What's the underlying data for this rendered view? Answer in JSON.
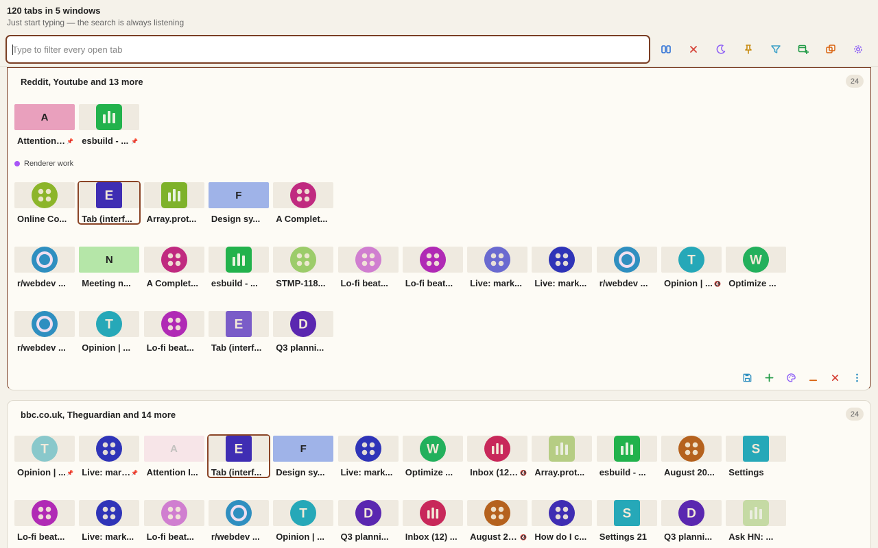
{
  "header": {
    "title": "120 tabs in 5 windows",
    "subtitle": "Just start typing — the search is always listening"
  },
  "search": {
    "placeholder": "Type to filter every open tab",
    "value": ""
  },
  "toolbar": [
    {
      "name": "split-view-icon",
      "color": "#2b6fd6"
    },
    {
      "name": "close-icon",
      "color": "#d6453a"
    },
    {
      "name": "moon-icon",
      "color": "#8b5cf6"
    },
    {
      "name": "pin-icon",
      "color": "#c78a0e"
    },
    {
      "name": "filter-icon",
      "color": "#3aa0c8"
    },
    {
      "name": "new-window-icon",
      "color": "#1f9a45"
    },
    {
      "name": "duplicate-icon",
      "color": "#d9630f"
    },
    {
      "name": "gear-icon",
      "color": "#8b5cf6"
    }
  ],
  "windows": [
    {
      "title": "Reddit, Youtube and 13 more",
      "count": "24",
      "group_label": "Renderer work",
      "pinned": [
        {
          "label": "Attention I...",
          "style": "flat",
          "letter": "A",
          "bg": "#e9a0bd",
          "pinned": true
        },
        {
          "label": "esbuild - ...",
          "style": "bars",
          "color": "#22b24c",
          "pinned": true
        }
      ],
      "group": [
        {
          "label": "Online Co...",
          "style": "dots",
          "color": "#8cb52a"
        },
        {
          "label": "Tab (interf...",
          "style": "letter",
          "letter": "E",
          "color": "#3f2db3",
          "active": true
        },
        {
          "label": "Array.prot...",
          "style": "bars",
          "color": "#7eb22a"
        },
        {
          "label": "Design sy...",
          "style": "flat",
          "letter": "F",
          "bg": "#9fb3e8"
        },
        {
          "label": "A Complet...",
          "style": "dots",
          "color": "#c02a80"
        }
      ],
      "row3": [
        {
          "label": "r/webdev ...",
          "style": "ring",
          "color": "#2f8fc0"
        },
        {
          "label": "Meeting n...",
          "style": "flat",
          "letter": "N",
          "bg": "#b5e6a8"
        },
        {
          "label": "A Complet...",
          "style": "dots",
          "color": "#c02a80"
        },
        {
          "label": "esbuild - ...",
          "style": "bars",
          "color": "#22b24c"
        },
        {
          "label": "STMP-118...",
          "style": "dots",
          "color": "#9ccc6a"
        },
        {
          "label": "Lo-fi beat...",
          "style": "dots",
          "color": "#d07ed0"
        },
        {
          "label": "Lo-fi beat...",
          "style": "dots",
          "color": "#b02ab5"
        },
        {
          "label": "Live: mark...",
          "style": "dots",
          "color": "#6a6ad0"
        },
        {
          "label": "Live: mark...",
          "style": "dots",
          "color": "#2f34b8"
        },
        {
          "label": "r/webdev ...",
          "style": "ring",
          "color": "#2f8fc0"
        },
        {
          "label": "Opinion | ...",
          "style": "letter",
          "letter": "T",
          "color": "#26a8b8",
          "muted": true
        },
        {
          "label": "Optimize ...",
          "style": "letter",
          "letter": "W",
          "color": "#23b05c"
        }
      ],
      "row4": [
        {
          "label": "r/webdev ...",
          "style": "ring",
          "color": "#2f8fc0"
        },
        {
          "label": "Opinion | ...",
          "style": "letter",
          "letter": "T",
          "color": "#26a8b8"
        },
        {
          "label": "Lo-fi beat...",
          "style": "dots",
          "color": "#b02ab5"
        },
        {
          "label": "Tab (interf...",
          "style": "letter",
          "letter": "E",
          "color": "#7a5cc8"
        },
        {
          "label": "Q3 planni...",
          "style": "letter",
          "letter": "D",
          "color": "#5a27b0"
        }
      ]
    },
    {
      "title": "bbc.co.uk, Theguardian and 14 more",
      "count": "24",
      "row1": [
        {
          "label": "Opinion | ...",
          "style": "letter",
          "letter": "T",
          "color": "#26a8b8",
          "faded": true,
          "pinned": true
        },
        {
          "label": "Live: mark...",
          "style": "dots",
          "color": "#2f34b8",
          "pinned": true
        },
        {
          "label": "Attention I...",
          "style": "flat",
          "letter": "A",
          "bg": "#e9a0bd",
          "faded": true
        },
        {
          "label": "Tab (interf...",
          "style": "letter",
          "letter": "E",
          "color": "#3f2db3",
          "active": true
        },
        {
          "label": "Design sy...",
          "style": "flat",
          "letter": "F",
          "bg": "#9fb3e8"
        },
        {
          "label": "Live: mark...",
          "style": "dots",
          "color": "#2f34b8"
        },
        {
          "label": "Optimize ...",
          "style": "letter",
          "letter": "W",
          "color": "#23b05c"
        },
        {
          "label": "Inbox (12) ...",
          "style": "bars",
          "color": "#c8285a",
          "muted": true
        },
        {
          "label": "Array.prot...",
          "style": "bars",
          "color": "#7eb22a",
          "faded": true
        },
        {
          "label": "esbuild - ...",
          "style": "bars",
          "color": "#22b24c"
        },
        {
          "label": "August 20...",
          "style": "dots",
          "color": "#b5621e"
        },
        {
          "label": "Settings",
          "style": "letter",
          "letter": "S",
          "color": "#26a8b8"
        }
      ],
      "row2": [
        {
          "label": "Lo-fi beat...",
          "style": "dots",
          "color": "#b02ab5"
        },
        {
          "label": "Live: mark...",
          "style": "dots",
          "color": "#2f34b8"
        },
        {
          "label": "Lo-fi beat...",
          "style": "dots",
          "color": "#d07ed0"
        },
        {
          "label": "r/webdev ...",
          "style": "ring",
          "color": "#2f8fc0"
        },
        {
          "label": "Opinion | ...",
          "style": "letter",
          "letter": "T",
          "color": "#26a8b8"
        },
        {
          "label": "Q3 planni...",
          "style": "letter",
          "letter": "D",
          "color": "#5a27b0"
        },
        {
          "label": "Inbox (12) ...",
          "style": "bars",
          "color": "#c8285a"
        },
        {
          "label": "August 20...",
          "style": "dots",
          "color": "#b5621e",
          "muted": true
        },
        {
          "label": "How do I c...",
          "style": "dots",
          "color": "#3f2db3"
        },
        {
          "label": "Settings 21",
          "style": "letter",
          "letter": "S",
          "color": "#26a8b8"
        },
        {
          "label": "Q3 planni...",
          "style": "letter",
          "letter": "D",
          "color": "#5a27b0"
        },
        {
          "label": "Ask HN: ...",
          "style": "bars",
          "color": "#9ccc6a",
          "faded": true
        }
      ]
    }
  ],
  "card_actions": [
    {
      "name": "save-icon",
      "color": "#2f8fc0"
    },
    {
      "name": "plus-icon",
      "color": "#1f9a45"
    },
    {
      "name": "palette-icon",
      "color": "#8b5cf6"
    },
    {
      "name": "minimize-icon",
      "color": "#d9630f"
    },
    {
      "name": "close-icon",
      "color": "#d6453a"
    },
    {
      "name": "more-icon",
      "color": "#2f8fc0"
    }
  ]
}
